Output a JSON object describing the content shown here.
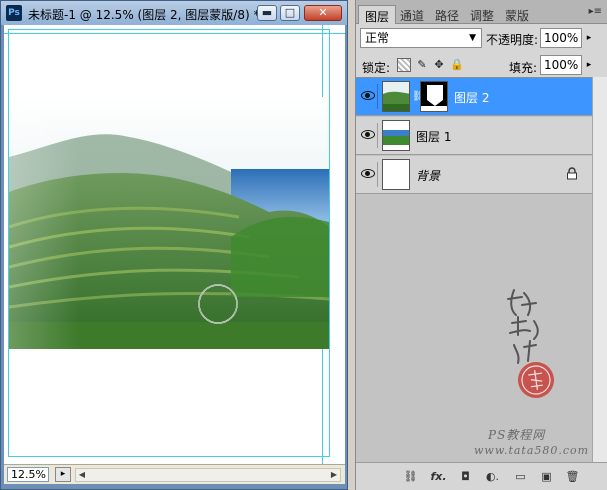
{
  "document": {
    "app_badge": "Ps",
    "title": "未标题-1 @ 12.5% (图层 2, 图层蒙版/8) *",
    "zoom": "12.5%"
  },
  "window_buttons": {
    "minimize": "▬",
    "maximize": "□",
    "close": "✕"
  },
  "panel": {
    "tabs": [
      "图层",
      "通道",
      "路径",
      "调整",
      "蒙版"
    ],
    "active_tab_index": 0,
    "menu_glyph": "▸≡",
    "blend_mode": "正常",
    "opacity_label": "不透明度:",
    "opacity_value": "100%",
    "lock_label": "锁定:",
    "fill_label": "填充:",
    "fill_value": "100%",
    "layers": [
      {
        "name": "图层 2",
        "selected": true,
        "has_mask": true,
        "thumb": "photo"
      },
      {
        "name": "图层 1",
        "selected": false,
        "has_mask": false,
        "thumb": "photo-small"
      },
      {
        "name": "背景",
        "selected": false,
        "has_mask": false,
        "thumb": "white",
        "locked": true
      }
    ],
    "footer_icons": [
      "link-icon",
      "fx-icon",
      "mask-icon",
      "adjustment-icon",
      "group-icon",
      "new-layer-icon",
      "trash-icon"
    ],
    "footer_glyphs": [
      "⛓",
      "fx.",
      "◘",
      "◐.",
      "▭",
      "▣",
      "🗑"
    ]
  },
  "watermark": {
    "text": "PS教程网",
    "url": "www.tata580.com"
  },
  "colors": {
    "selection": "#3d95ff",
    "guide": "#42d0e0"
  }
}
